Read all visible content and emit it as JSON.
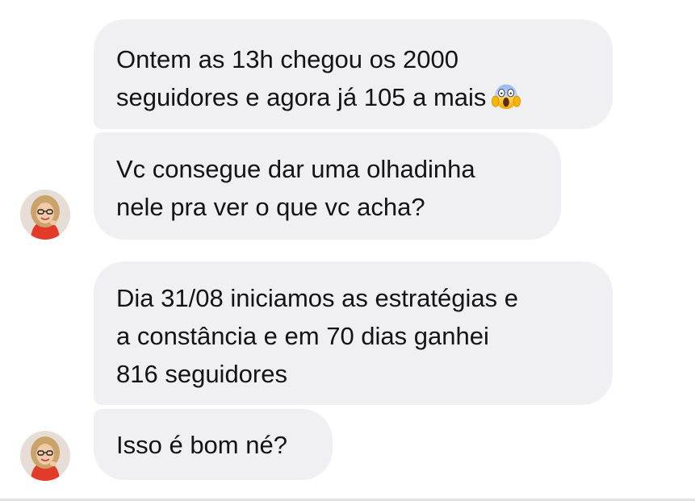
{
  "messages": [
    {
      "sender": "contact",
      "text": "Ontem as 13h chegou os 2000\nseguidores e agora já 105 a mais",
      "emoji": "face-screaming-in-fear-icon"
    },
    {
      "sender": "contact",
      "text": "Vc consegue dar uma olhadinha\nnele pra ver o que vc acha?"
    },
    {
      "sender": "contact",
      "text": "Dia 31/08 iniciamos as estratégias e\na constância e em 70 dias ganhei\n816 seguidores"
    },
    {
      "sender": "contact",
      "text": "Isso é bom né?"
    }
  ],
  "colors": {
    "bubble_bg": "#f0f0f2",
    "text": "#141414",
    "background": "#ffffff"
  }
}
